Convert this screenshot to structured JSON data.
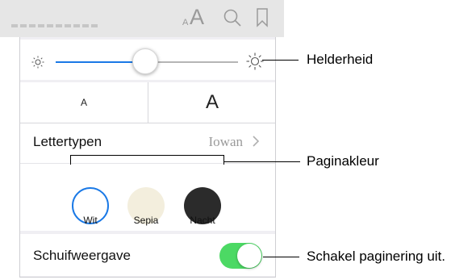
{
  "toolbar": {
    "font_icon_small": "A",
    "font_icon_large": "A",
    "search_icon": "search-icon",
    "bookmark_icon": "bookmark-icon"
  },
  "brightness": {
    "level_percent": 58,
    "min_icon": "sun-small-icon",
    "max_icon": "sun-large-icon"
  },
  "font_size": {
    "smaller_label": "A",
    "larger_label": "A"
  },
  "fonts": {
    "label": "Lettertypen",
    "value": "Iowan"
  },
  "themes": [
    {
      "label": "Wit",
      "color": "#ffffff",
      "selected": true
    },
    {
      "label": "Sepia",
      "color": "#f3eedd",
      "selected": false
    },
    {
      "label": "Nacht",
      "color": "#2b2b2b",
      "selected": false
    }
  ],
  "scroll": {
    "label": "Schuifweergave",
    "on": true,
    "toggle_color": "#4cd964"
  },
  "callouts": {
    "brightness": "Helderheid",
    "page_color": "Paginakleur",
    "toggle": "Schakel paginering uit."
  },
  "colors": {
    "accent": "#1a79e6"
  }
}
